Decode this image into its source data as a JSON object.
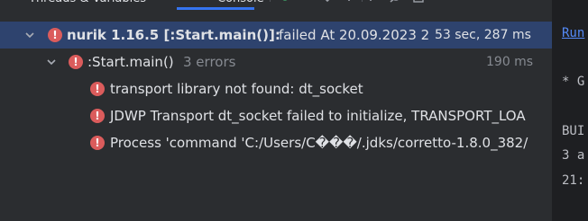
{
  "tabs": {
    "threads_label": "Threads & Variables",
    "console_label": "Console"
  },
  "tree": {
    "root": {
      "name": "nurik 1.16.5 [:Start.main()]:",
      "status": "failed At 20.09.2023 2",
      "duration": "53 sec, 287 ms"
    },
    "task": {
      "name": ":Start.main()",
      "count": "3 errors",
      "duration": "190 ms"
    },
    "errors": [
      "transport library not found: dt_socket",
      "JDWP Transport dt_socket failed to initialize, TRANSPORT_LOA",
      "Process 'command 'C:/Users/C���/.jdks/corretto-1.8.0_382/"
    ]
  },
  "console": {
    "lines": [
      "Run",
      "* G",
      "BUI",
      "3 a",
      "21:"
    ]
  },
  "colors": {
    "selection": "#2e436e",
    "error_icon": "#db5c5c",
    "accent": "#3574f0",
    "link": "#548af7"
  },
  "icons": [
    "chevron-down-icon",
    "error-icon"
  ]
}
